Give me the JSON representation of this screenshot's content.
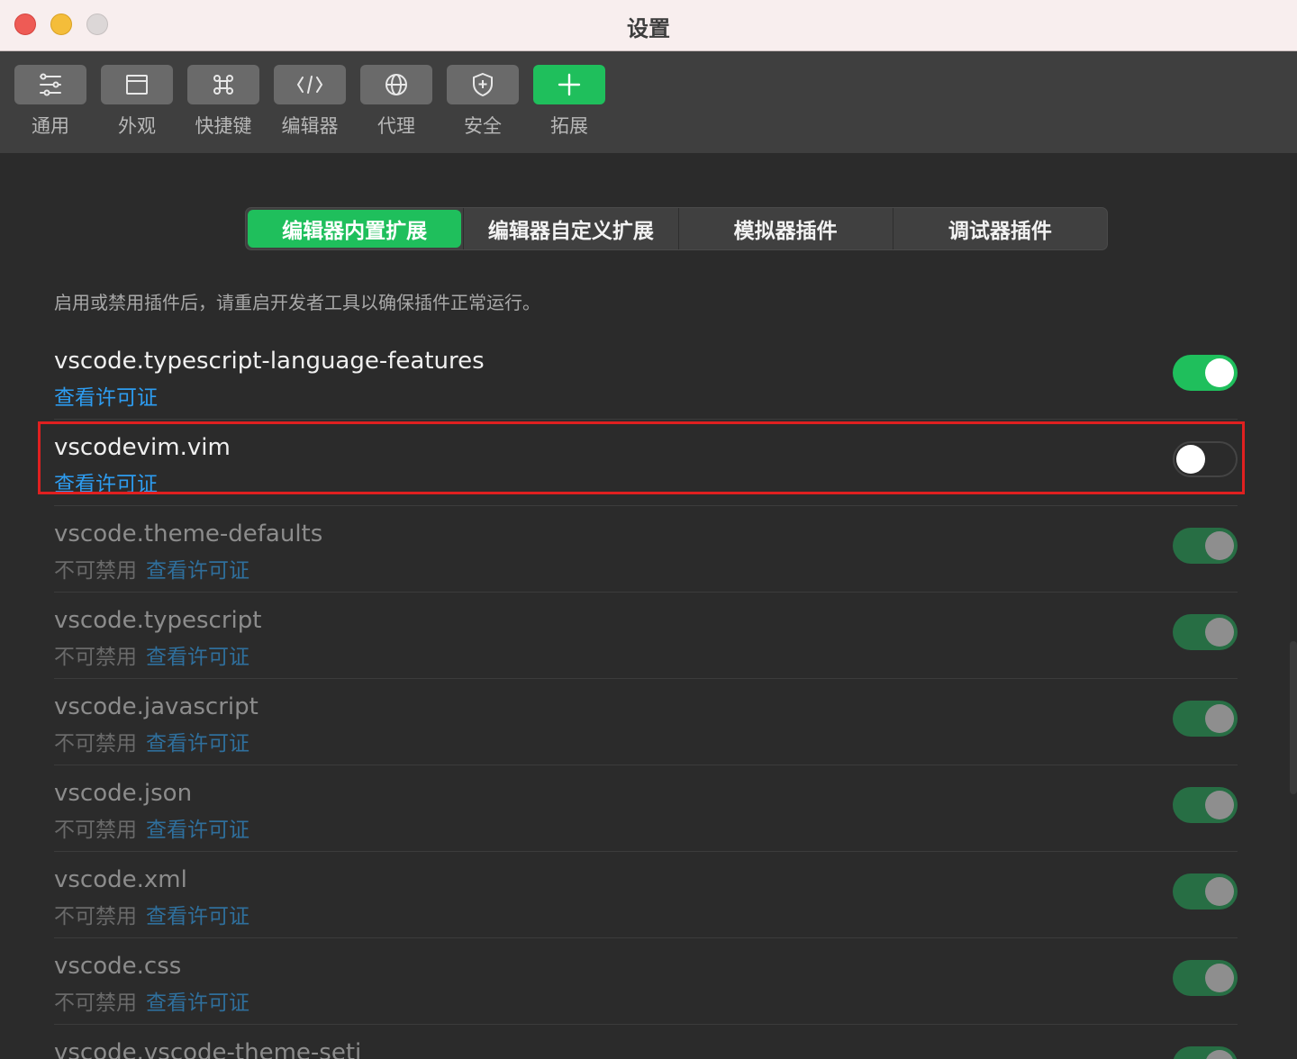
{
  "window": {
    "title": "设置",
    "accent_color": "#1fbf5c",
    "link_color": "#2d9cf0"
  },
  "toolbar": {
    "items": [
      {
        "label": "通用",
        "icon": "sliders-icon"
      },
      {
        "label": "外观",
        "icon": "window-icon"
      },
      {
        "label": "快捷键",
        "icon": "command-key-icon"
      },
      {
        "label": "编辑器",
        "icon": "code-icon"
      },
      {
        "label": "代理",
        "icon": "globe-icon"
      },
      {
        "label": "安全",
        "icon": "shield-icon"
      },
      {
        "label": "拓展",
        "icon": "plus-icon"
      }
    ]
  },
  "tabs": {
    "items": [
      {
        "label": "编辑器内置扩展"
      },
      {
        "label": "编辑器自定义扩展"
      },
      {
        "label": "模拟器插件"
      },
      {
        "label": "调试器插件"
      }
    ]
  },
  "notice": "启用或禁用插件后，请重启开发者工具以确保插件正常运行。",
  "extensions": {
    "locked_label": "不可禁用",
    "license_label": "查看许可证",
    "items": [
      {
        "name": "vscode.typescript-language-features",
        "enabled": true,
        "locked": false
      },
      {
        "name": "vscodevim.vim",
        "enabled": false,
        "locked": false
      },
      {
        "name": "vscode.theme-defaults",
        "enabled": true,
        "locked": true
      },
      {
        "name": "vscode.typescript",
        "enabled": true,
        "locked": true
      },
      {
        "name": "vscode.javascript",
        "enabled": true,
        "locked": true
      },
      {
        "name": "vscode.json",
        "enabled": true,
        "locked": true
      },
      {
        "name": "vscode.xml",
        "enabled": true,
        "locked": true
      },
      {
        "name": "vscode.css",
        "enabled": true,
        "locked": true
      },
      {
        "name": "vscode.vscode-theme-seti",
        "enabled": true,
        "locked": true
      }
    ]
  }
}
